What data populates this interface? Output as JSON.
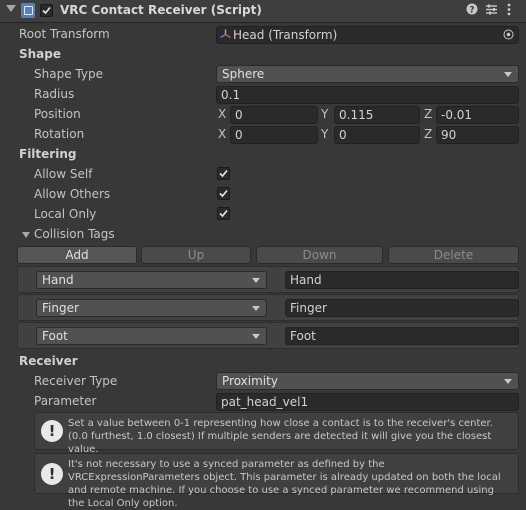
{
  "header": {
    "title": "VRC Contact Receiver (Script)",
    "enabled": true,
    "icons": [
      "help-icon",
      "preset-icon",
      "kebab-menu-icon"
    ]
  },
  "root_transform": {
    "label": "Root Transform",
    "value": "Head (Transform)"
  },
  "shape": {
    "heading": "Shape",
    "type_label": "Shape Type",
    "type_value": "Sphere",
    "radius_label": "Radius",
    "radius_value": "0.1",
    "position_label": "Position",
    "position": {
      "x_label": "X",
      "x": "0",
      "y_label": "Y",
      "y": "0.115",
      "z_label": "Z",
      "z": "-0.01"
    },
    "rotation_label": "Rotation",
    "rotation": {
      "x_label": "X",
      "x": "0",
      "y_label": "Y",
      "y": "0",
      "z_label": "Z",
      "z": "90"
    }
  },
  "filtering": {
    "heading": "Filtering",
    "allow_self_label": "Allow Self",
    "allow_self": true,
    "allow_others_label": "Allow Others",
    "allow_others": true,
    "local_only_label": "Local Only",
    "local_only": true,
    "collision_tags_label": "Collision Tags",
    "buttons": {
      "add": "Add",
      "up": "Up",
      "down": "Down",
      "delete": "Delete"
    },
    "tags": [
      {
        "selected": "Hand",
        "value": "Hand"
      },
      {
        "selected": "Finger",
        "value": "Finger"
      },
      {
        "selected": "Foot",
        "value": "Foot"
      }
    ]
  },
  "receiver": {
    "heading": "Receiver",
    "type_label": "Receiver Type",
    "type_value": "Proximity",
    "parameter_label": "Parameter",
    "parameter_value": "pat_head_vel1",
    "help1": "Set a value between 0-1 representing how close a contact is to the receiver's center. (0.0 furthest, 1.0 closest)  If multiple senders are detected it will give you the closest value.",
    "help2": "It's not necessary to use a synced parameter as defined by the VRCExpressionParameters object.  This parameter is already updated on both the local and remote machine.  If you choose to use a synced parameter we recommend using the Local Only option."
  },
  "colors": {
    "background": "#383838",
    "field": "#2a2a2a",
    "dropdown": "#515151"
  }
}
